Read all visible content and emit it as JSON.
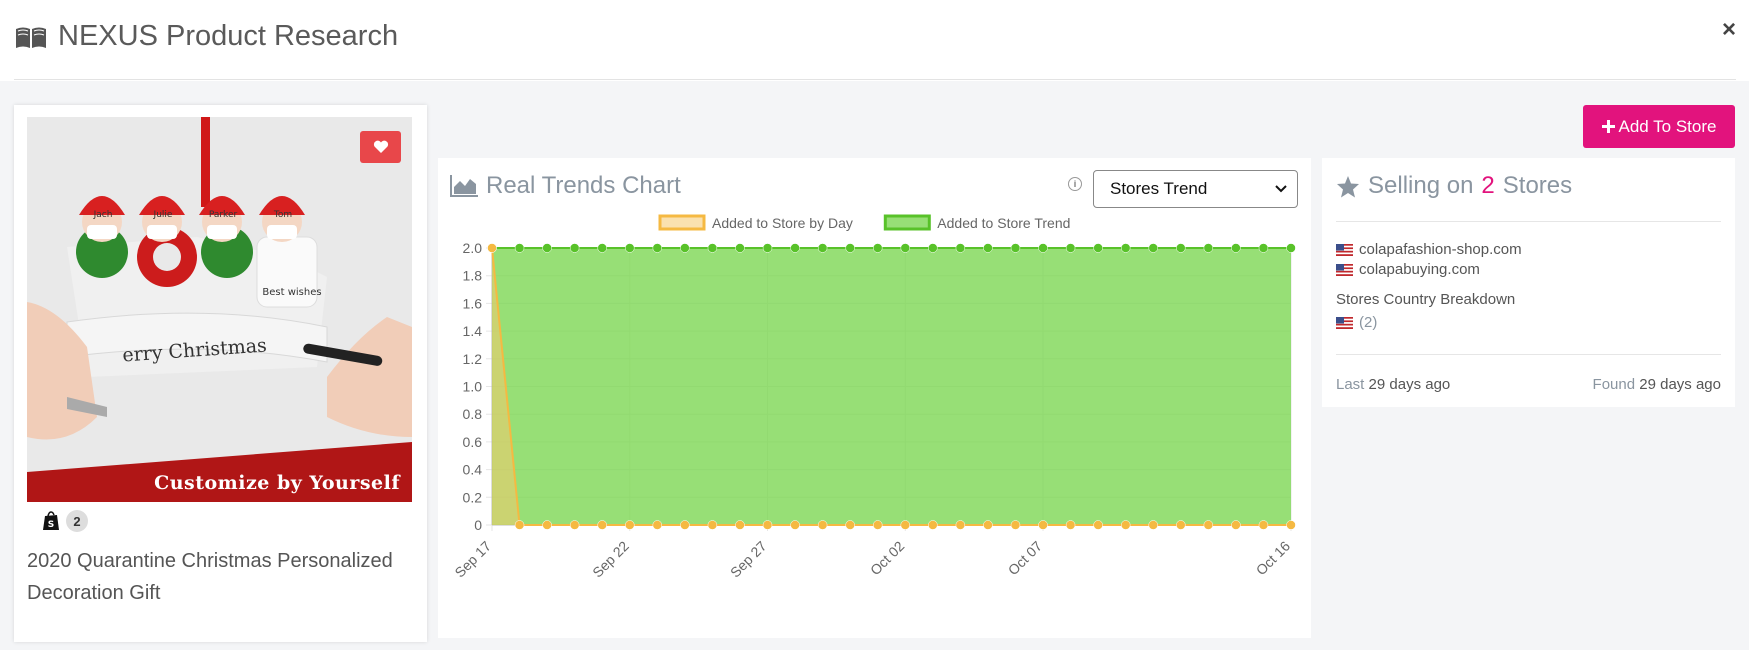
{
  "header": {
    "title": "NEXUS Product Research",
    "close_label": "×"
  },
  "product": {
    "title": "2020 Quarantine Christmas Personalized Decoration Gift",
    "store_count": "2",
    "image_labels": [
      "Jach",
      "Julie",
      "Parker",
      "Tom"
    ],
    "image_side_text": "Best wishes",
    "image_ribbon_text": "erry Christmas",
    "image_banner": "Customize by Yourself"
  },
  "actions": {
    "add_to_store": "Add To Store"
  },
  "chart_panel": {
    "heading": "Real Trends Chart",
    "info_icon": "i",
    "select_value": "Stores Trend"
  },
  "chart_data": {
    "type": "area",
    "x": [
      "Sep 17",
      "Sep 18",
      "Sep 19",
      "Sep 20",
      "Sep 21",
      "Sep 22",
      "Sep 23",
      "Sep 24",
      "Sep 25",
      "Sep 26",
      "Sep 27",
      "Sep 28",
      "Sep 29",
      "Sep 30",
      "Oct 01",
      "Oct 02",
      "Oct 03",
      "Oct 04",
      "Oct 05",
      "Oct 06",
      "Oct 07",
      "Oct 08",
      "Oct 09",
      "Oct 10",
      "Oct 11",
      "Oct 12",
      "Oct 13",
      "Oct 14",
      "Oct 15",
      "Oct 16"
    ],
    "x_tick_labels": [
      "Sep 17",
      "Sep 22",
      "Sep 27",
      "Oct 02",
      "Oct 07",
      "Oct 16"
    ],
    "y_tick_labels": [
      "0",
      "0.2",
      "0.4",
      "0.6",
      "0.8",
      "1.0",
      "1.2",
      "1.4",
      "1.6",
      "1.8",
      "2.0"
    ],
    "ylim": [
      0,
      2
    ],
    "grid": true,
    "legend_position": "top",
    "series": [
      {
        "name": "Added to Store by Day",
        "color": "#f5b942",
        "fill": "rgba(246,200,110,0.55)",
        "values": [
          2,
          0,
          0,
          0,
          0,
          0,
          0,
          0,
          0,
          0,
          0,
          0,
          0,
          0,
          0,
          0,
          0,
          0,
          0,
          0,
          0,
          0,
          0,
          0,
          0,
          0,
          0,
          0,
          0,
          0
        ]
      },
      {
        "name": "Added to Store Trend",
        "color": "#58c229",
        "fill": "rgba(122,214,80,0.78)",
        "values": [
          2,
          2,
          2,
          2,
          2,
          2,
          2,
          2,
          2,
          2,
          2,
          2,
          2,
          2,
          2,
          2,
          2,
          2,
          2,
          2,
          2,
          2,
          2,
          2,
          2,
          2,
          2,
          2,
          2,
          2
        ]
      }
    ]
  },
  "stores_panel": {
    "heading_prefix": "Selling on",
    "heading_count": "2",
    "heading_suffix": "Stores",
    "stores": [
      "colapafashion-shop.com",
      "colapabuying.com"
    ],
    "breakdown_label": "Stores Country Breakdown",
    "breakdown_count": "(2)",
    "last_label": "Last",
    "last_value": "29 days ago",
    "found_label": "Found",
    "found_value": "29 days ago"
  },
  "colors": {
    "accent": "#e2137d",
    "fav": "#e8474a",
    "heading": "#8a95a0"
  }
}
